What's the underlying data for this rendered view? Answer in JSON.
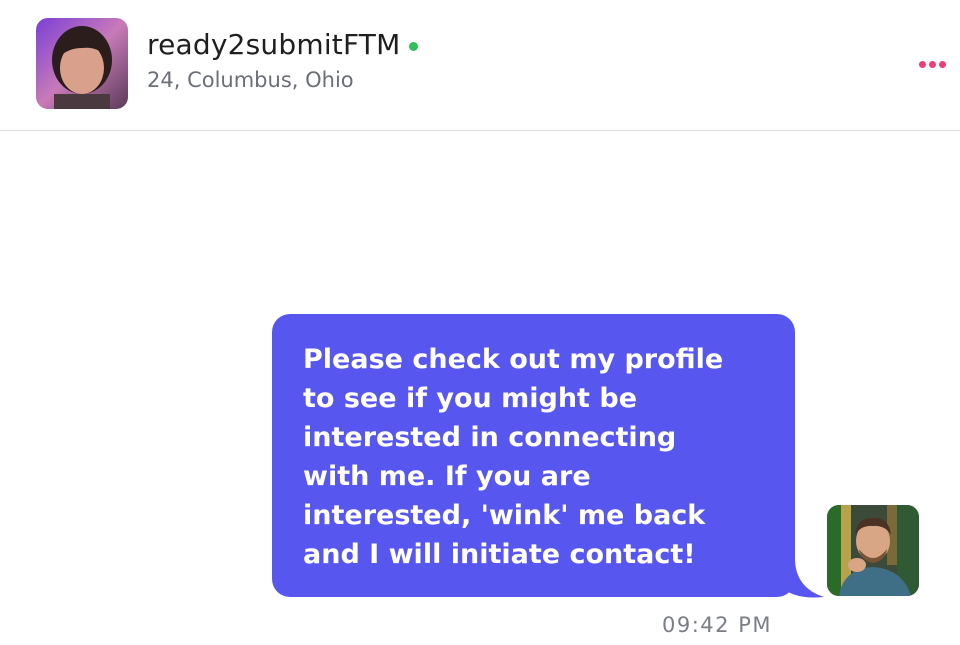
{
  "header": {
    "username": "ready2submitFTM",
    "subtitle": "24, Columbus, Ohio",
    "online_status_color": "#2ec15a",
    "menu_icon": "more-horizontal-icon",
    "menu_color": "#ee3f75"
  },
  "message": {
    "text": "Please check out my profile\nto see if you might be\ninterested in connecting\nwith me. If you are\ninterested, 'wink' me back\nand I will initiate contact!",
    "timestamp": "09:42 PM",
    "bubble_color": "#5757f0"
  }
}
